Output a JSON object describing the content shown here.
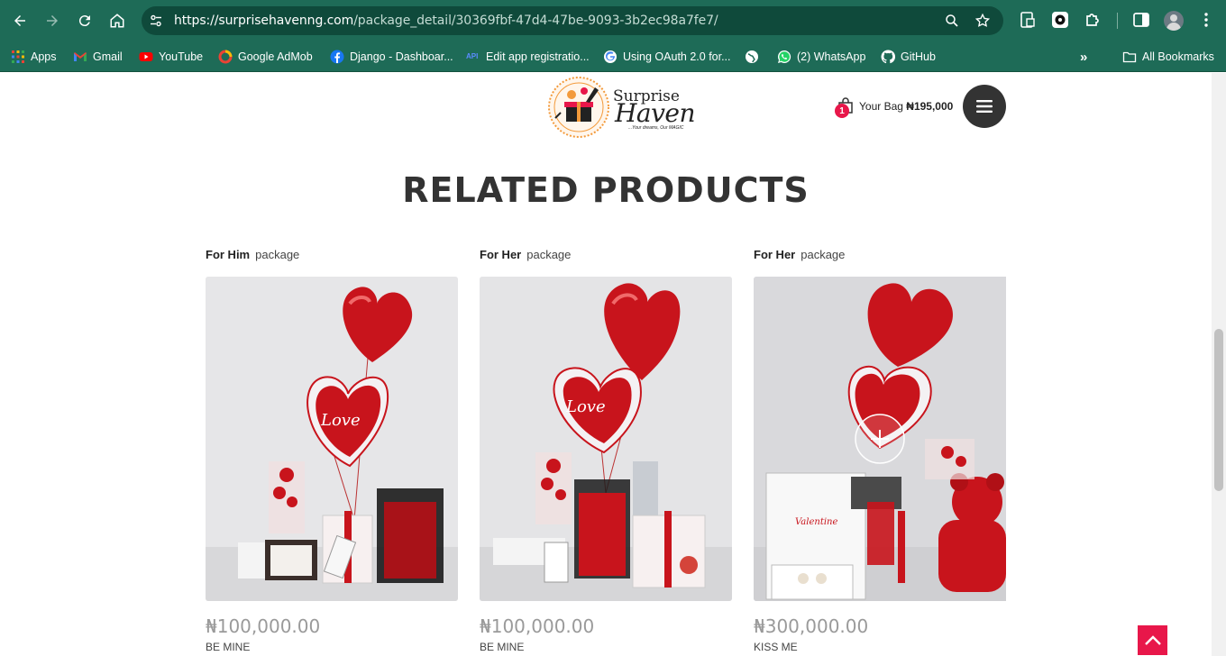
{
  "browser": {
    "url_host": "https://surprisehavenng.com",
    "url_path": "/package_detail/30369fbf-47d4-47be-9093-3b2ec98a7fe7/",
    "bookmarks": [
      {
        "label": "Apps",
        "icon": "apps-grid-icon"
      },
      {
        "label": "Gmail",
        "icon": "gmail-icon"
      },
      {
        "label": "YouTube",
        "icon": "youtube-icon"
      },
      {
        "label": "Google AdMob",
        "icon": "admob-icon"
      },
      {
        "label": "Django - Dashboar...",
        "icon": "facebook-icon"
      },
      {
        "label": "Edit app registratio...",
        "icon": "api-icon"
      },
      {
        "label": "Using OAuth 2.0 for...",
        "icon": "google-icon"
      },
      {
        "label": "",
        "icon": "globe-icon"
      },
      {
        "label": "(2) WhatsApp",
        "icon": "whatsapp-icon"
      },
      {
        "label": "GitHub",
        "icon": "github-icon"
      }
    ],
    "all_bookmarks": "All Bookmarks",
    "colors": {
      "frame": "#1e6b57",
      "omnibox": "#0f4a3b"
    }
  },
  "header": {
    "logo_line1": "Surprise",
    "logo_line2": "Haven",
    "logo_tagline": "...Your dreams, Our MAGIC",
    "bag_count": "1",
    "bag_label": "Your Bag",
    "bag_total": "₦195,000"
  },
  "section": {
    "title": "RELATED PRODUCTS"
  },
  "products": [
    {
      "category": "For Him",
      "type": "package",
      "price": "₦100,000.00",
      "name": "BE MINE"
    },
    {
      "category": "For Her",
      "type": "package",
      "price": "₦100,000.00",
      "name": "BE MINE"
    },
    {
      "category": "For Her",
      "type": "package",
      "price": "₦300,000.00",
      "name": "KISS ME"
    }
  ],
  "colors": {
    "accent": "#e8174a",
    "title": "#333333",
    "balloon_red": "#c8141c"
  }
}
